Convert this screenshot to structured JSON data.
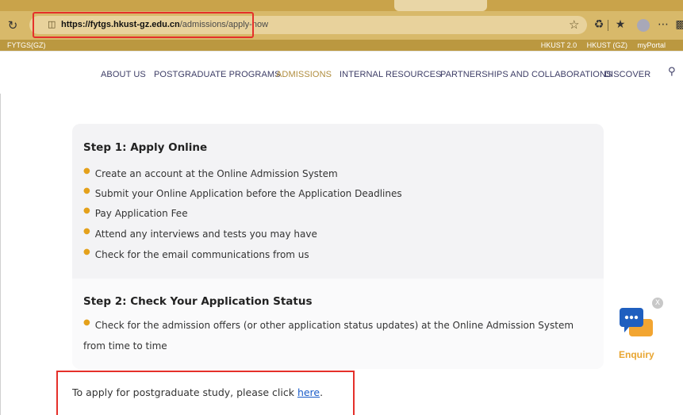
{
  "browser": {
    "url_host": "https://fytgs.hkust-gz.edu.cn",
    "url_path": "/admissions/apply-now",
    "icons": [
      "reload-icon",
      "lock-icon",
      "favorite-star-icon",
      "extensions-icon",
      "favorites-icon",
      "profile-avatar",
      "more-icon"
    ]
  },
  "site": {
    "brand": "FYTGS(GZ)",
    "top_links": [
      "HKUST 2.0",
      "HKUST (GZ)",
      "myPortal"
    ]
  },
  "nav": {
    "items": [
      "ABOUT US",
      "POSTGRADUATE PROGRAMS",
      "ADMISSIONS",
      "INTERNAL RESOURCES",
      "PARTNERSHIPS AND COLLABORATIONS",
      "DISCOVER"
    ],
    "active": "ADMISSIONS"
  },
  "steps": [
    {
      "title": "Step 1: Apply Online",
      "bullets": [
        "Create an account at the Online Admission System",
        "Submit your Online Application before the Application Deadlines",
        "Pay Application Fee",
        "Attend any interviews and tests you may have",
        "Check for the email communications from us"
      ]
    },
    {
      "title": "Step 2: Check Your Application Status",
      "bullets": [
        "Check for the admission offers (or other application status updates) at the Online Admission System from time to time"
      ]
    }
  ],
  "apply": {
    "prefix": "To apply for postgraduate study, please click ",
    "link": "here",
    "suffix": "."
  },
  "enquiry": {
    "label": "Enquiry",
    "close": "X"
  },
  "colors": {
    "toolbar": "#d8b96a",
    "site_bar": "#bb9840",
    "nav_active": "#b08d3e",
    "highlight": "#e5302a",
    "link": "#1a5cc8",
    "bullet": "#e4a11b"
  }
}
